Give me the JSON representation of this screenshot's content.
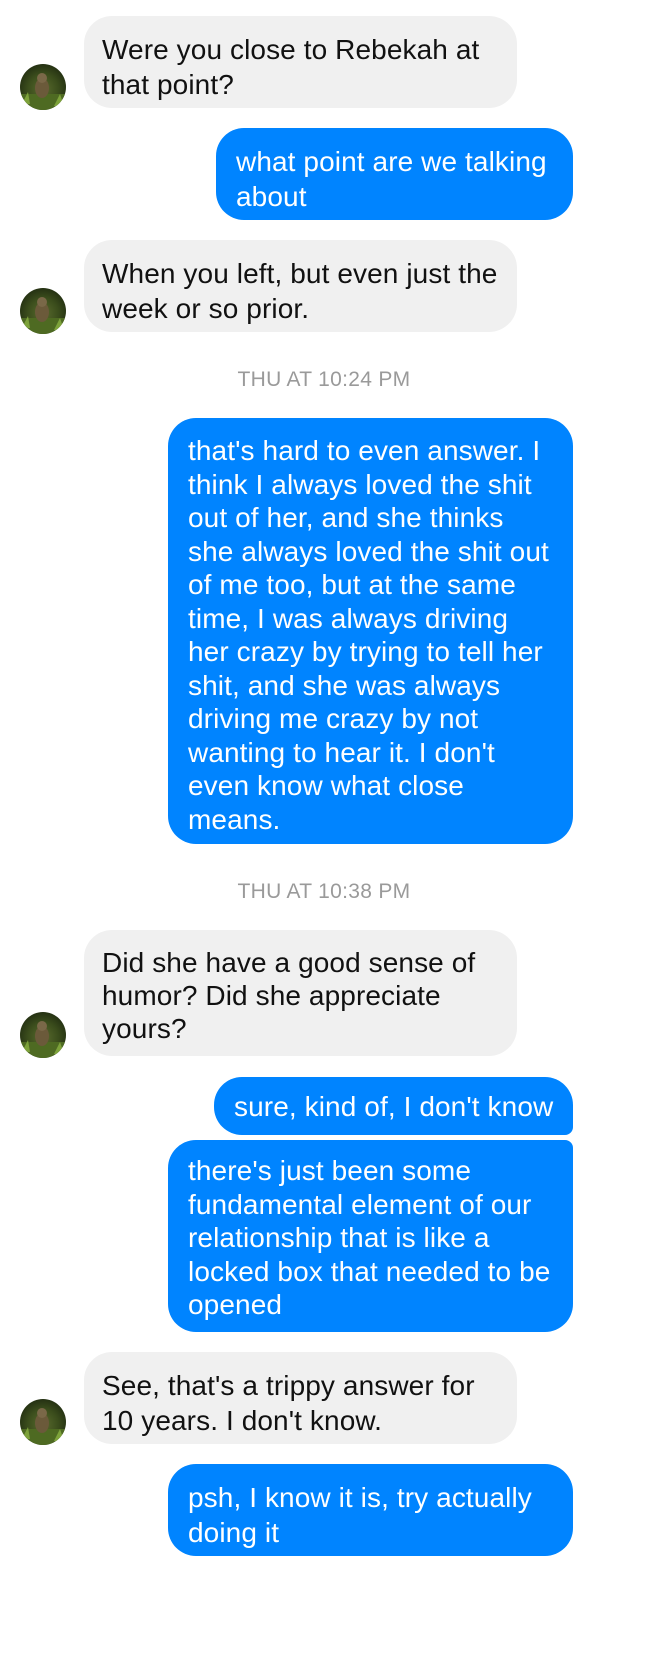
{
  "conversation": {
    "messages": [
      {
        "id": "m1",
        "direction": "incoming",
        "text": "Were you close to Rebekah at that point?"
      },
      {
        "id": "m2",
        "direction": "outgoing",
        "text": "what point are we talking about"
      },
      {
        "id": "m3",
        "direction": "incoming",
        "text": "When you left, but even just the week or so prior."
      },
      {
        "id": "m4",
        "direction": "outgoing",
        "text": "that's hard to even answer. I think I always loved the shit out of her, and she thinks she always loved the shit out of me too, but at the same time, I was always driving her crazy by trying to tell her shit, and she was always driving me crazy by not wanting to hear it. I don't even know what close means."
      },
      {
        "id": "m5",
        "direction": "incoming",
        "text": "Did she have a good sense of humor? Did she appreciate yours?"
      },
      {
        "id": "m6",
        "direction": "outgoing",
        "text": "sure, kind of, I don't know"
      },
      {
        "id": "m7",
        "direction": "outgoing",
        "text": "there's just been some fundamental element of our relationship that is like a locked box that needed to be opened"
      },
      {
        "id": "m8",
        "direction": "incoming",
        "text": "See, that's a trippy answer for 10 years. I don't know."
      },
      {
        "id": "m9",
        "direction": "outgoing",
        "text": "psh, I know it is, try actually doing it"
      }
    ],
    "timestamps": [
      {
        "id": "t1",
        "text": "THU AT 10:24 PM"
      },
      {
        "id": "t2",
        "text": "THU AT 10:38 PM"
      }
    ]
  },
  "colors": {
    "incoming_bubble": "#f0f0f0",
    "incoming_text": "#111111",
    "outgoing_bubble": "#0084ff",
    "outgoing_text": "#ffffff",
    "timestamp_text": "#9a9a9a"
  },
  "icons": {
    "avatar": "contact-avatar-photo"
  }
}
